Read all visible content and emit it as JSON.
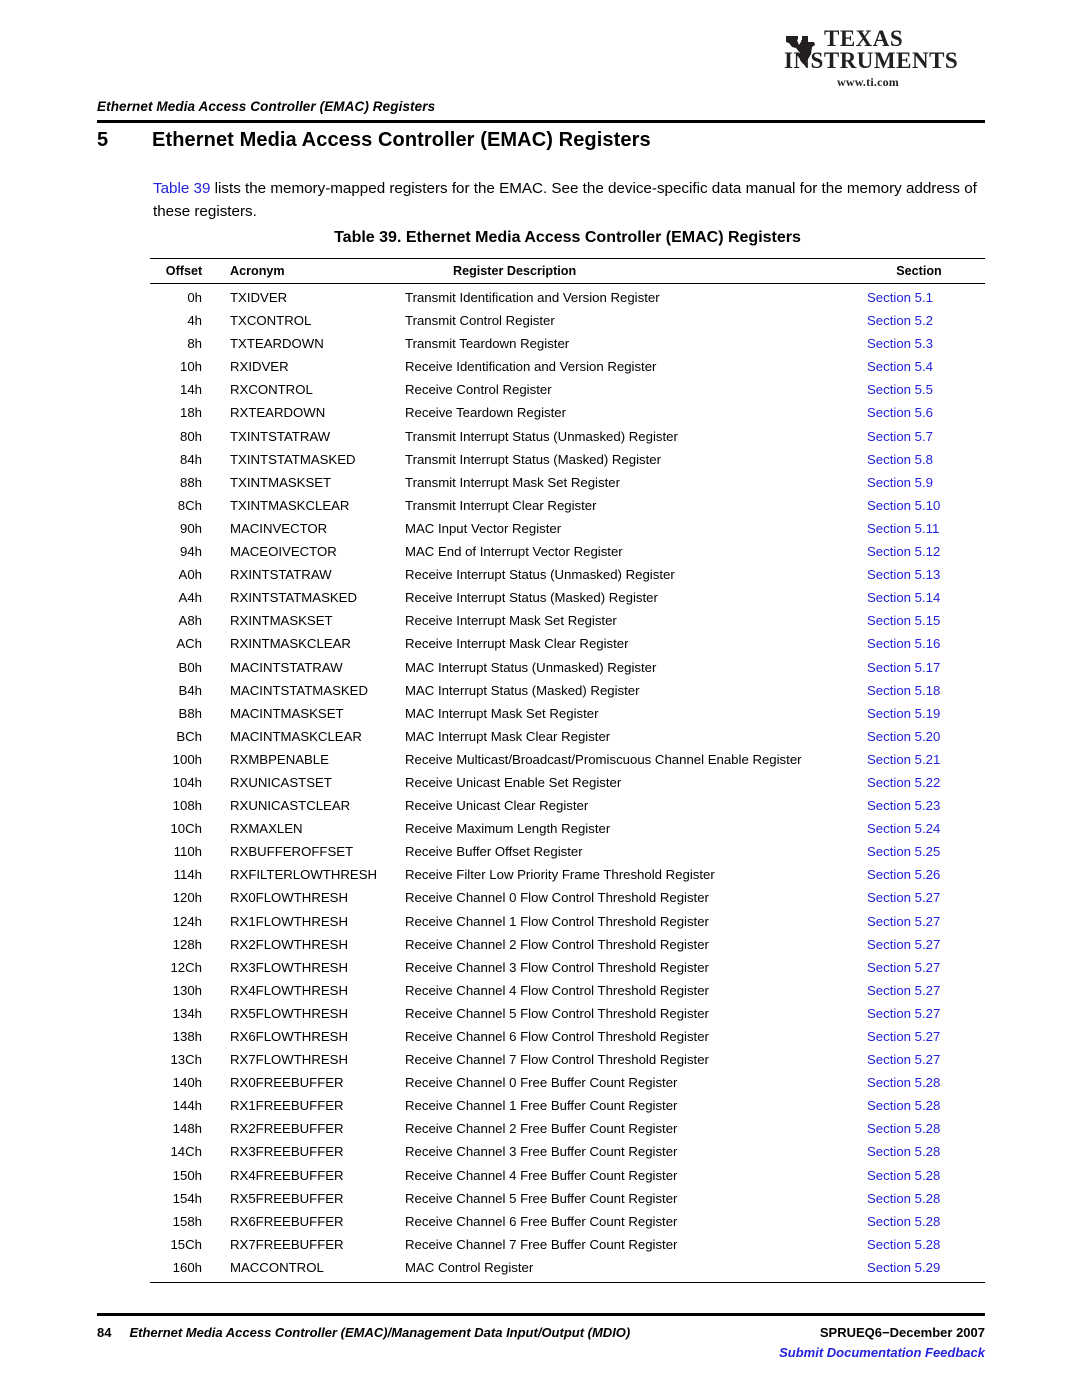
{
  "header": {
    "logo": {
      "line1": "TEXAS",
      "line2": "INSTRUMENTS",
      "url": "www.ti.com",
      "state_icon": "texas-state-icon"
    },
    "running_head": "Ethernet Media Access Controller (EMAC) Registers"
  },
  "chapter": {
    "number": "5",
    "title": "Ethernet Media Access Controller (EMAC) Registers"
  },
  "intro": {
    "link_text": "Table 39",
    "body": " lists the memory-mapped registers for the EMAC. See the device-specific data manual for the memory address of these registers."
  },
  "table": {
    "caption": "Table 39. Ethernet Media Access Controller (EMAC) Registers",
    "columns": [
      "Offset",
      "Acronym",
      "Register Description",
      "Section"
    ],
    "link_color": "#2222dd",
    "rows": [
      [
        "0h",
        "TXIDVER",
        "Transmit Identification and Version Register",
        "Section 5.1"
      ],
      [
        "4h",
        "TXCONTROL",
        "Transmit Control Register",
        "Section 5.2"
      ],
      [
        "8h",
        "TXTEARDOWN",
        "Transmit Teardown Register",
        "Section 5.3"
      ],
      [
        "10h",
        "RXIDVER",
        "Receive Identification and Version Register",
        "Section 5.4"
      ],
      [
        "14h",
        "RXCONTROL",
        "Receive Control Register",
        "Section 5.5"
      ],
      [
        "18h",
        "RXTEARDOWN",
        "Receive Teardown Register",
        "Section 5.6"
      ],
      [
        "80h",
        "TXINTSTATRAW",
        "Transmit Interrupt Status (Unmasked) Register",
        "Section 5.7"
      ],
      [
        "84h",
        "TXINTSTATMASKED",
        "Transmit Interrupt Status (Masked) Register",
        "Section 5.8"
      ],
      [
        "88h",
        "TXINTMASKSET",
        "Transmit Interrupt Mask Set Register",
        "Section 5.9"
      ],
      [
        "8Ch",
        "TXINTMASKCLEAR",
        "Transmit Interrupt Clear Register",
        "Section 5.10"
      ],
      [
        "90h",
        "MACINVECTOR",
        "MAC Input Vector Register",
        "Section 5.11"
      ],
      [
        "94h",
        "MACEOIVECTOR",
        "MAC End of Interrupt Vector Register",
        "Section 5.12"
      ],
      [
        "A0h",
        "RXINTSTATRAW",
        "Receive Interrupt Status (Unmasked) Register",
        "Section 5.13"
      ],
      [
        "A4h",
        "RXINTSTATMASKED",
        "Receive Interrupt Status (Masked) Register",
        "Section 5.14"
      ],
      [
        "A8h",
        "RXINTMASKSET",
        "Receive Interrupt Mask Set Register",
        "Section 5.15"
      ],
      [
        "ACh",
        "RXINTMASKCLEAR",
        "Receive Interrupt Mask Clear Register",
        "Section 5.16"
      ],
      [
        "B0h",
        "MACINTSTATRAW",
        "MAC Interrupt Status (Unmasked) Register",
        "Section 5.17"
      ],
      [
        "B4h",
        "MACINTSTATMASKED",
        "MAC Interrupt Status (Masked) Register",
        "Section 5.18"
      ],
      [
        "B8h",
        "MACINTMASKSET",
        "MAC Interrupt Mask Set Register",
        "Section 5.19"
      ],
      [
        "BCh",
        "MACINTMASKCLEAR",
        "MAC Interrupt Mask Clear Register",
        "Section 5.20"
      ],
      [
        "100h",
        "RXMBPENABLE",
        "Receive Multicast/Broadcast/Promiscuous Channel Enable Register",
        "Section 5.21"
      ],
      [
        "104h",
        "RXUNICASTSET",
        "Receive Unicast Enable Set Register",
        "Section 5.22"
      ],
      [
        "108h",
        "RXUNICASTCLEAR",
        "Receive Unicast Clear Register",
        "Section 5.23"
      ],
      [
        "10Ch",
        "RXMAXLEN",
        "Receive Maximum Length Register",
        "Section 5.24"
      ],
      [
        "110h",
        "RXBUFFEROFFSET",
        "Receive Buffer Offset Register",
        "Section 5.25"
      ],
      [
        "114h",
        "RXFILTERLOWTHRESH",
        "Receive Filter Low Priority Frame Threshold Register",
        "Section 5.26"
      ],
      [
        "120h",
        "RX0FLOWTHRESH",
        "Receive Channel 0 Flow Control Threshold Register",
        "Section 5.27"
      ],
      [
        "124h",
        "RX1FLOWTHRESH",
        "Receive Channel 1 Flow Control Threshold Register",
        "Section 5.27"
      ],
      [
        "128h",
        "RX2FLOWTHRESH",
        "Receive Channel 2 Flow Control Threshold Register",
        "Section 5.27"
      ],
      [
        "12Ch",
        "RX3FLOWTHRESH",
        "Receive Channel 3 Flow Control Threshold Register",
        "Section 5.27"
      ],
      [
        "130h",
        "RX4FLOWTHRESH",
        "Receive Channel 4 Flow Control Threshold Register",
        "Section 5.27"
      ],
      [
        "134h",
        "RX5FLOWTHRESH",
        "Receive Channel 5 Flow Control Threshold Register",
        "Section 5.27"
      ],
      [
        "138h",
        "RX6FLOWTHRESH",
        "Receive Channel 6 Flow Control Threshold Register",
        "Section 5.27"
      ],
      [
        "13Ch",
        "RX7FLOWTHRESH",
        "Receive Channel 7 Flow Control Threshold Register",
        "Section 5.27"
      ],
      [
        "140h",
        "RX0FREEBUFFER",
        "Receive Channel 0 Free Buffer Count Register",
        "Section 5.28"
      ],
      [
        "144h",
        "RX1FREEBUFFER",
        "Receive Channel 1 Free Buffer Count Register",
        "Section 5.28"
      ],
      [
        "148h",
        "RX2FREEBUFFER",
        "Receive Channel 2 Free Buffer Count Register",
        "Section 5.28"
      ],
      [
        "14Ch",
        "RX3FREEBUFFER",
        "Receive Channel 3 Free Buffer Count Register",
        "Section 5.28"
      ],
      [
        "150h",
        "RX4FREEBUFFER",
        "Receive Channel 4 Free Buffer Count Register",
        "Section 5.28"
      ],
      [
        "154h",
        "RX5FREEBUFFER",
        "Receive Channel 5 Free Buffer Count Register",
        "Section 5.28"
      ],
      [
        "158h",
        "RX6FREEBUFFER",
        "Receive Channel 6 Free Buffer Count Register",
        "Section 5.28"
      ],
      [
        "15Ch",
        "RX7FREEBUFFER",
        "Receive Channel 7 Free Buffer Count Register",
        "Section 5.28"
      ],
      [
        "160h",
        "MACCONTROL",
        "MAC Control Register",
        "Section 5.29"
      ]
    ]
  },
  "footer": {
    "page_number": "84",
    "title": "Ethernet Media Access Controller (EMAC)/Management Data Input/Output (MDIO)",
    "doc_id": "SPRUEQ6−December 2007",
    "feedback": "Submit Documentation Feedback"
  }
}
